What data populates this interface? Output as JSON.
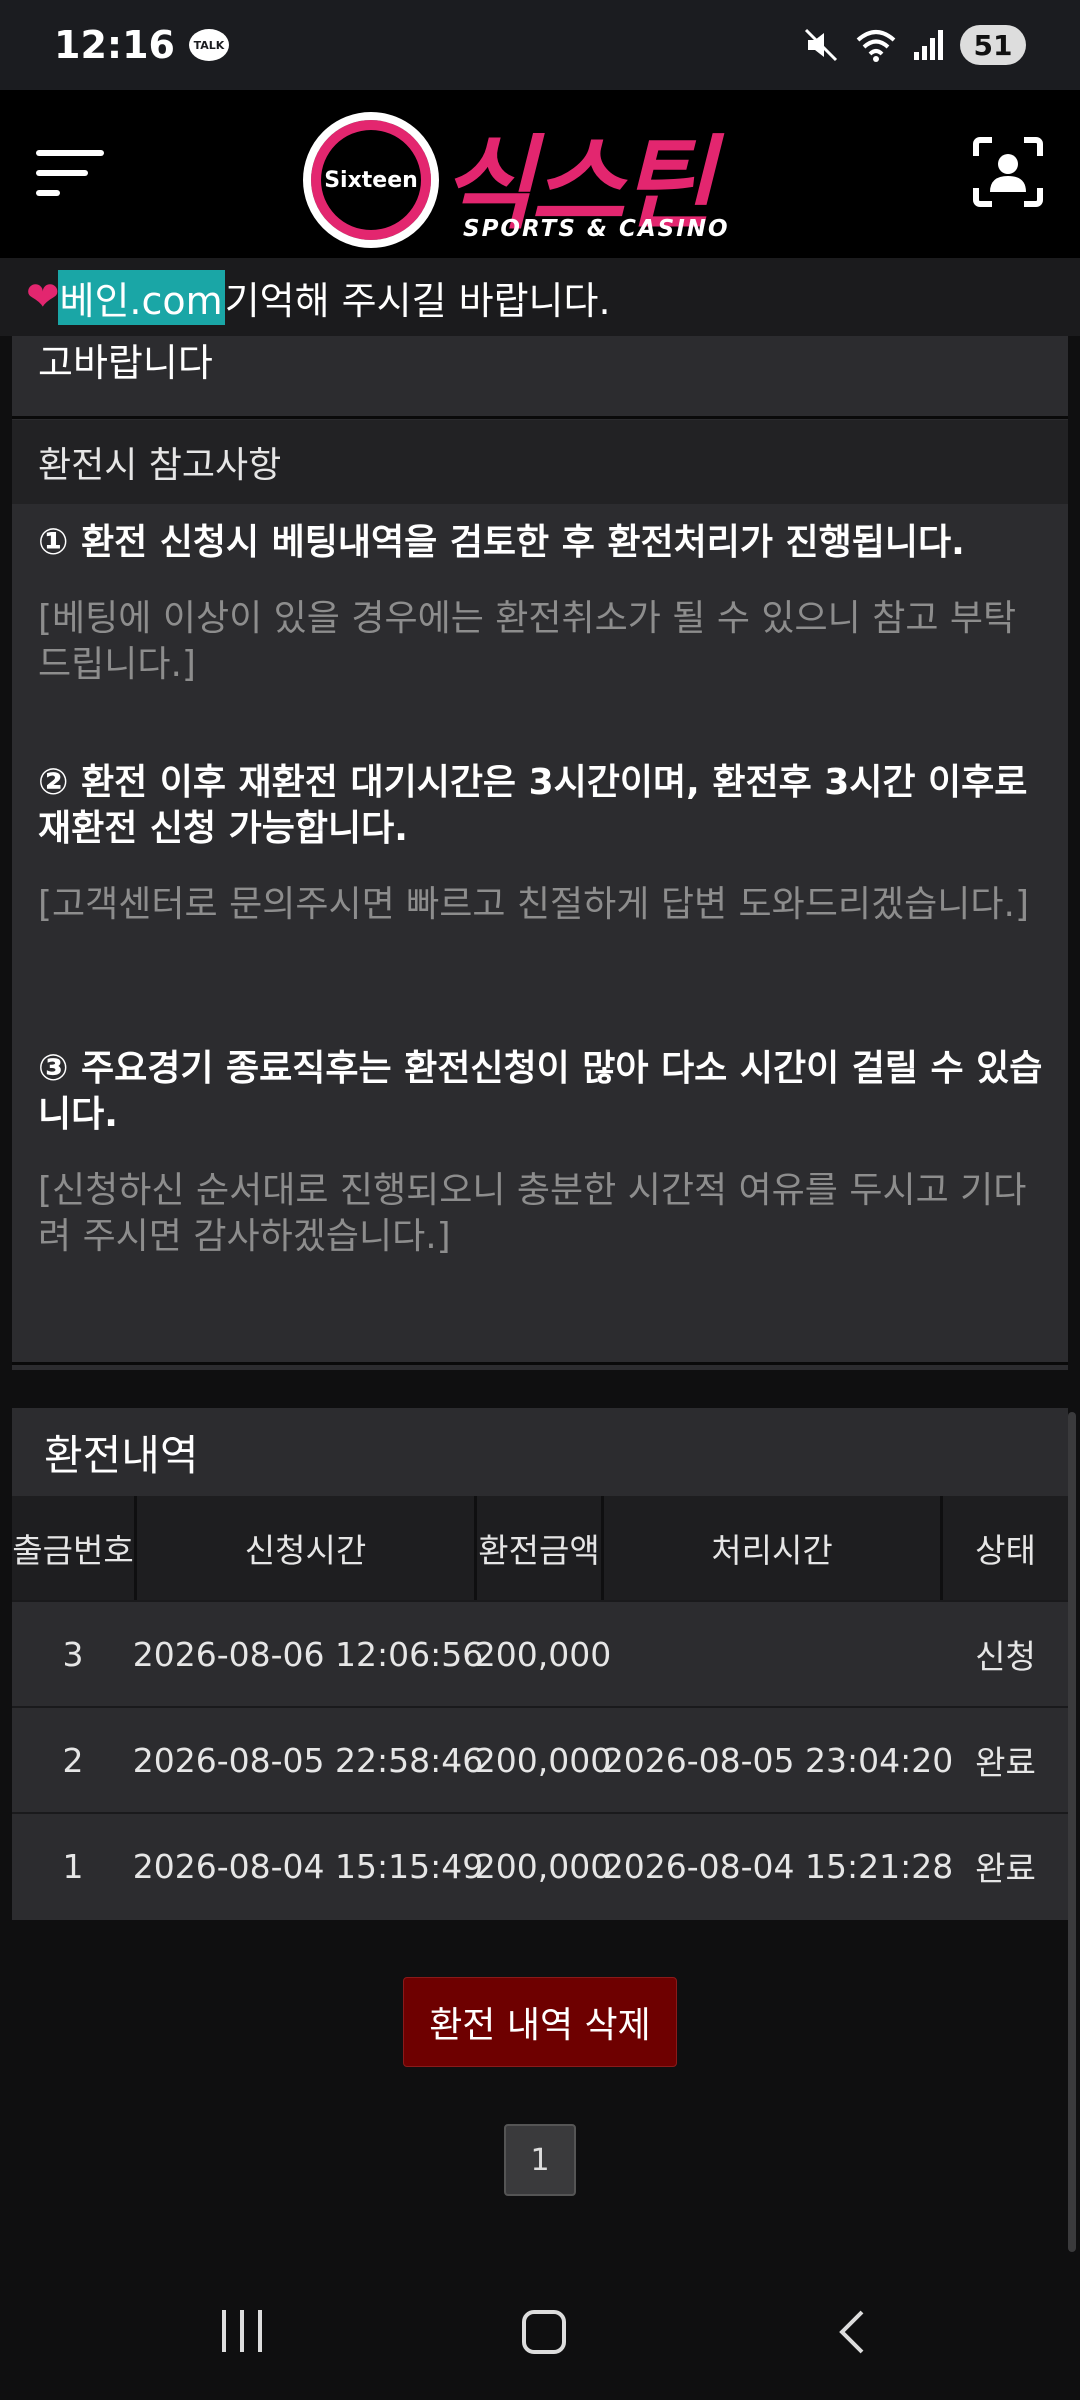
{
  "status_bar": {
    "time": "12:16",
    "talk_badge": "TALK",
    "battery": "51",
    "icons": [
      "mute-icon",
      "wifi-icon",
      "signal-icon"
    ]
  },
  "header": {
    "logo_text": "식스틴",
    "logo_badge": "Sixteen",
    "logo_sub": "SPORTS & CASINO"
  },
  "marquee": {
    "domain": "베인.com",
    "text": " 기억해 주시길 바랍니다."
  },
  "notice": {
    "cut_text": "고바랍니다",
    "heading": "환전시 참고사항",
    "items": [
      {
        "title": "① 환전 신청시 베팅내역을 검토한 후 환전처리가 진행됩니다.",
        "desc": "[베팅에 이상이 있을 경우에는 환전취소가 될 수 있으니 참고 부탁드립니다.]"
      },
      {
        "title": "② 환전 이후 재환전 대기시간은 3시간이며, 환전후 3시간 이후로 재환전 신청 가능합니다.",
        "desc": "[고객센터로 문의주시면 빠르고 친절하게 답변 도와드리겠습니다.]"
      },
      {
        "title": "③ 주요경기 종료직후는 환전신청이 많아 다소 시간이 걸릴 수 있습니다.",
        "desc": "[신청하신 순서대로 진행되오니 충분한 시간적 여유를 두시고 기다려 주시면 감사하겠습니다.]"
      }
    ]
  },
  "history": {
    "title": "환전내역",
    "columns": [
      "출금번호",
      "신청시간",
      "환전금액",
      "처리시간",
      "상태"
    ],
    "rows": [
      {
        "no": "3",
        "requested": "2026-08-06 12:06:56",
        "amount": "200,000",
        "processed": "",
        "status": "신청"
      },
      {
        "no": "2",
        "requested": "2026-08-05 22:58:46",
        "amount": "200,000",
        "processed": "2026-08-05 23:04:20",
        "status": "완료"
      },
      {
        "no": "1",
        "requested": "2026-08-04 15:15:49",
        "amount": "200,000",
        "processed": "2026-08-04 15:21:28",
        "status": "완료"
      }
    ],
    "delete_button": "환전 내역 삭제",
    "page": "1"
  },
  "colors": {
    "brand": "#e3266f",
    "panel": "#2c2c2f",
    "delete": "#6e0000",
    "domain_highlight": "#1aa6a6"
  }
}
